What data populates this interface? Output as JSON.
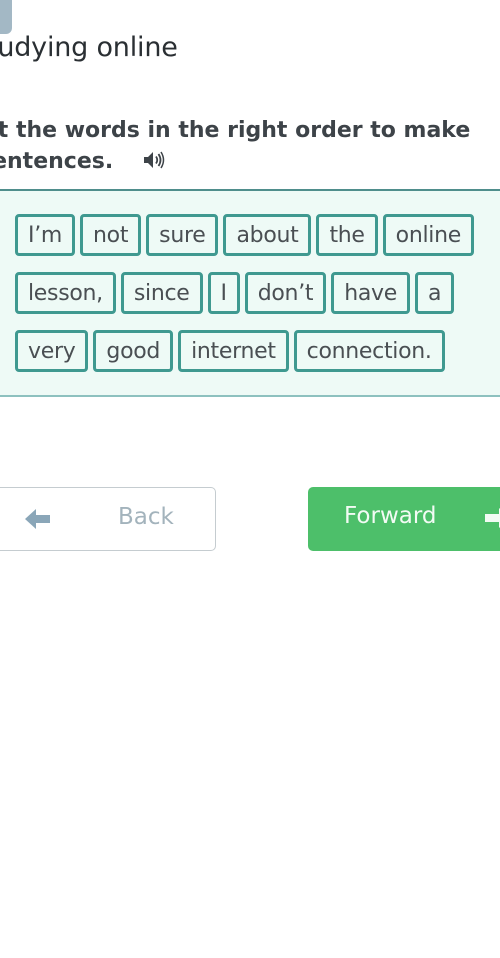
{
  "header": {
    "lesson_title": "Studying online"
  },
  "task": {
    "instruction_line1": "Put the words in the right order to make",
    "instruction_line2": "sentences.",
    "audio_icon": "speaker-icon"
  },
  "word_bank": {
    "rows": [
      [
        "I’m",
        "not",
        "sure",
        "about",
        "the",
        "online"
      ],
      [
        "lesson,",
        "since",
        "I",
        "don’t",
        "have",
        "a"
      ],
      [
        "very",
        "good",
        "internet",
        "connection."
      ]
    ]
  },
  "navigation": {
    "back_label": "Back",
    "back_icon": "arrow-left-icon",
    "forward_label": "Forward",
    "forward_icon": "arrow-right-icon"
  },
  "colors": {
    "word_border": "#3f9990",
    "word_area_bg": "#eefaf6",
    "forward_bg": "#4dbf6a",
    "back_text": "#a3b3bc"
  }
}
